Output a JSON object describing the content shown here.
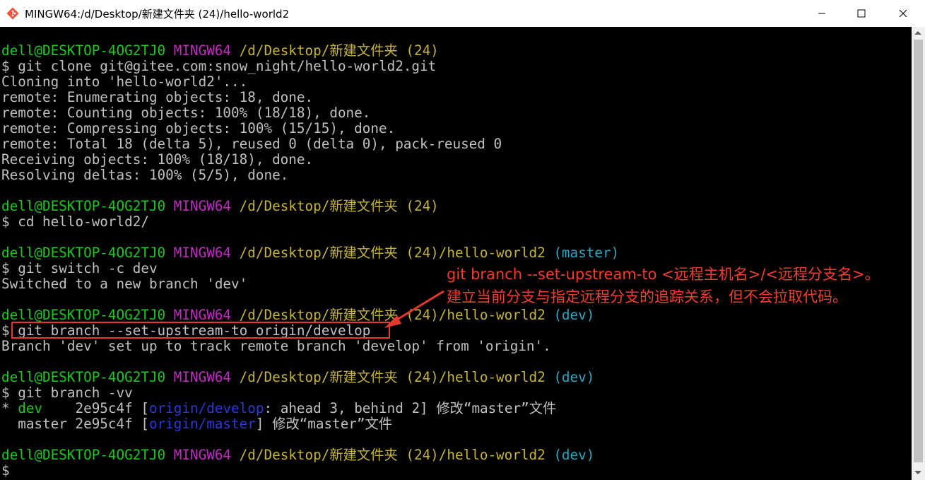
{
  "window": {
    "title": "MINGW64:/d/Desktop/新建文件夹 (24)/hello-world2",
    "minimize_icon": "minimize-icon",
    "maximize_icon": "maximize-icon",
    "close_icon": "close-icon"
  },
  "prompt": {
    "user": "dell@DESKTOP-4OG2TJ0",
    "shell": "MINGW64",
    "path_base": "/d/Desktop/新建文件夹 (24)",
    "path_sub": "/hello-world2",
    "branch_master": "(master)",
    "branch_dev": "(dev)",
    "symbol": "$"
  },
  "lines": {
    "l2_cmd": " git clone git@gitee.com:snow_night/hello-world2.git",
    "l3": "Cloning into 'hello-world2'...",
    "l4": "remote: Enumerating objects: 18, done.",
    "l5": "remote: Counting objects: 100% (18/18), done.",
    "l6": "remote: Compressing objects: 100% (15/15), done.",
    "l7": "remote: Total 18 (delta 5), reused 0 (delta 0), pack-reused 0",
    "l8": "Receiving objects: 100% (18/18), done.",
    "l9": "Resolving deltas: 100% (5/5), done.",
    "l12_cmd": " cd hello-world2/",
    "l15_cmd": " git switch -c dev",
    "l16": "Switched to a new branch 'dev'",
    "l18_cmd": " git branch --set-upstream-to origin/develop",
    "l19": "Branch 'dev' set up to track remote branch 'develop' from 'origin'.",
    "l21_cmd": " git branch -vv",
    "l22_star": "* ",
    "l22_branch": "dev",
    "l22_hash": "    2e95c4f [",
    "l22_remote": "origin/develop",
    "l22_rest": ": ahead 3, behind 2] 修改“master”文件",
    "l23_pre": "  master 2e95c4f [",
    "l23_remote": "origin/master",
    "l23_rest": "] 修改“master”文件"
  },
  "annotation": {
    "line1": "git branch --set-upstream-to <远程主机名>/<远程分支名>。",
    "line2": "建立当前分支与指定远程分支的追踪关系，但不会拉取代码。"
  },
  "colors": {
    "user": "#1fc61f",
    "shell": "#c22ac2",
    "path": "#c5b33a",
    "branch": "#2aa6c2",
    "remote_ref": "#2b39d6",
    "annotation": "#f13e2e"
  }
}
